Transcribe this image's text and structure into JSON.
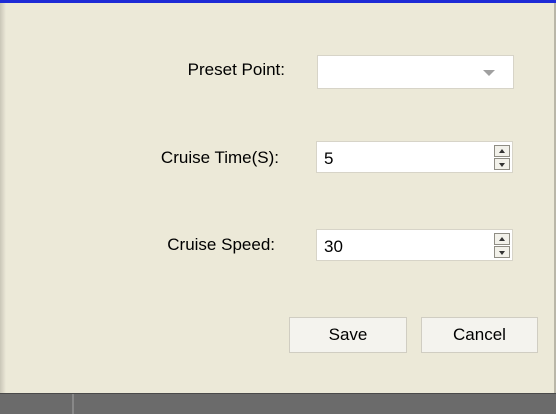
{
  "form": {
    "preset_point": {
      "label": "Preset Point:",
      "value": ""
    },
    "cruise_time": {
      "label": "Cruise Time(S):",
      "value": "5"
    },
    "cruise_speed": {
      "label": "Cruise Speed:",
      "value": "30"
    }
  },
  "buttons": {
    "save": "Save",
    "cancel": "Cancel"
  },
  "colors": {
    "accent": "#1e2bd6",
    "background": "#ece9d8"
  }
}
